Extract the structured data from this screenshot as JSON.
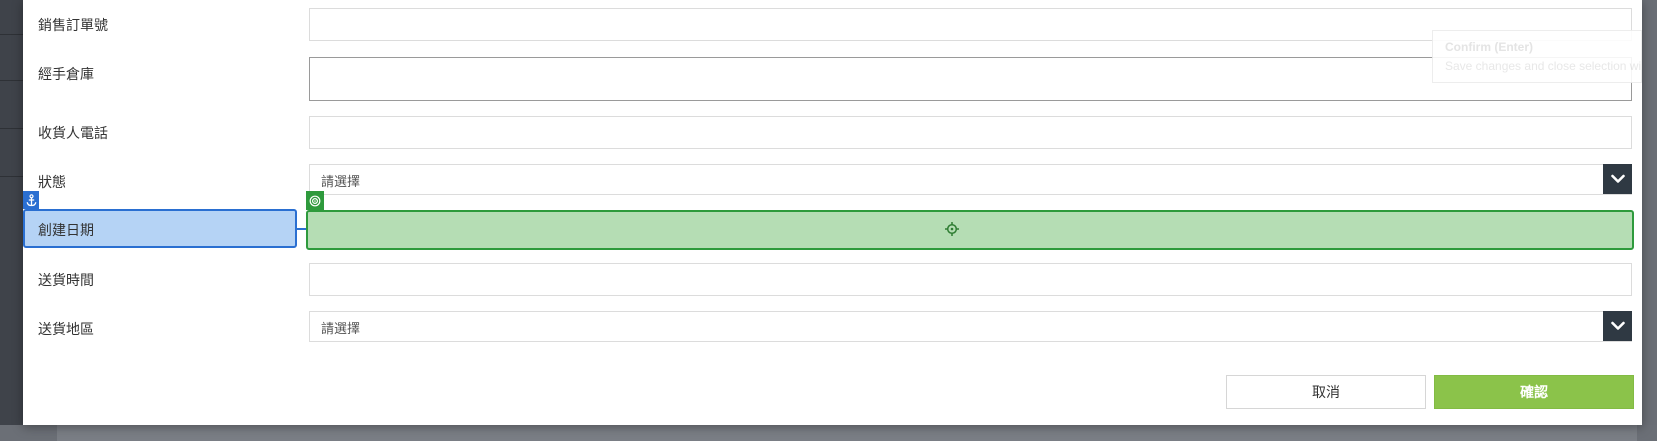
{
  "form": {
    "fields": [
      {
        "label": "銷售訂單號",
        "value": ""
      },
      {
        "label": "經手倉庫",
        "value": ""
      },
      {
        "label": "收貨人電話",
        "value": ""
      },
      {
        "label": "狀態",
        "placeholder": "請選擇"
      },
      {
        "label": "創建日期",
        "value": ""
      },
      {
        "label": "送貨時間",
        "value": ""
      },
      {
        "label": "送貨地區",
        "placeholder": "請選擇"
      }
    ]
  },
  "tooltip": {
    "title": "Confirm (Enter)",
    "description": "Save changes and close selection wi"
  },
  "buttons": {
    "cancel": "取消",
    "confirm": "確認"
  },
  "icons": {
    "dropdown": "chevron-down-icon",
    "anchor": "anchor-icon",
    "target": "target-icon",
    "crosshair": "crosshair-icon"
  },
  "colors": {
    "confirm_button": "#8bc34a",
    "dropdown_arrow_bg": "#2f3943",
    "anchor_highlight": "#b5d3f5",
    "anchor_border": "#2a6fd1",
    "target_highlight": "#b5ddb4",
    "target_border": "#2e9a3c"
  }
}
